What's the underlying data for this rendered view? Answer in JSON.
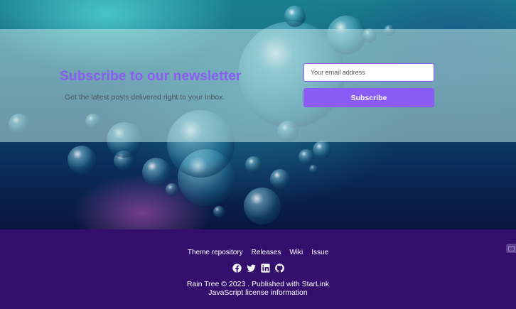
{
  "newsletter": {
    "title": "Subscribe to our newsletter",
    "subtitle": "Get the latest posts delivered right to your inbox.",
    "email_placeholder": "Your email address",
    "subscribe_label": "Subscribe"
  },
  "footer": {
    "nav": [
      {
        "label": "Theme repository"
      },
      {
        "label": "Releases"
      },
      {
        "label": "Wiki"
      },
      {
        "label": "Issue"
      }
    ],
    "social_icons": [
      "facebook-icon",
      "twitter-icon",
      "linkedin-icon",
      "github-icon"
    ],
    "copyright_brand": "Rain Tree",
    "copyright_rest": " © 2023 . Published with ",
    "copyright_platform": "StarLink",
    "license_link": "JavaScript license information"
  },
  "colors": {
    "accent": "#8b5cf6",
    "footer_bg": "#340e6c"
  }
}
